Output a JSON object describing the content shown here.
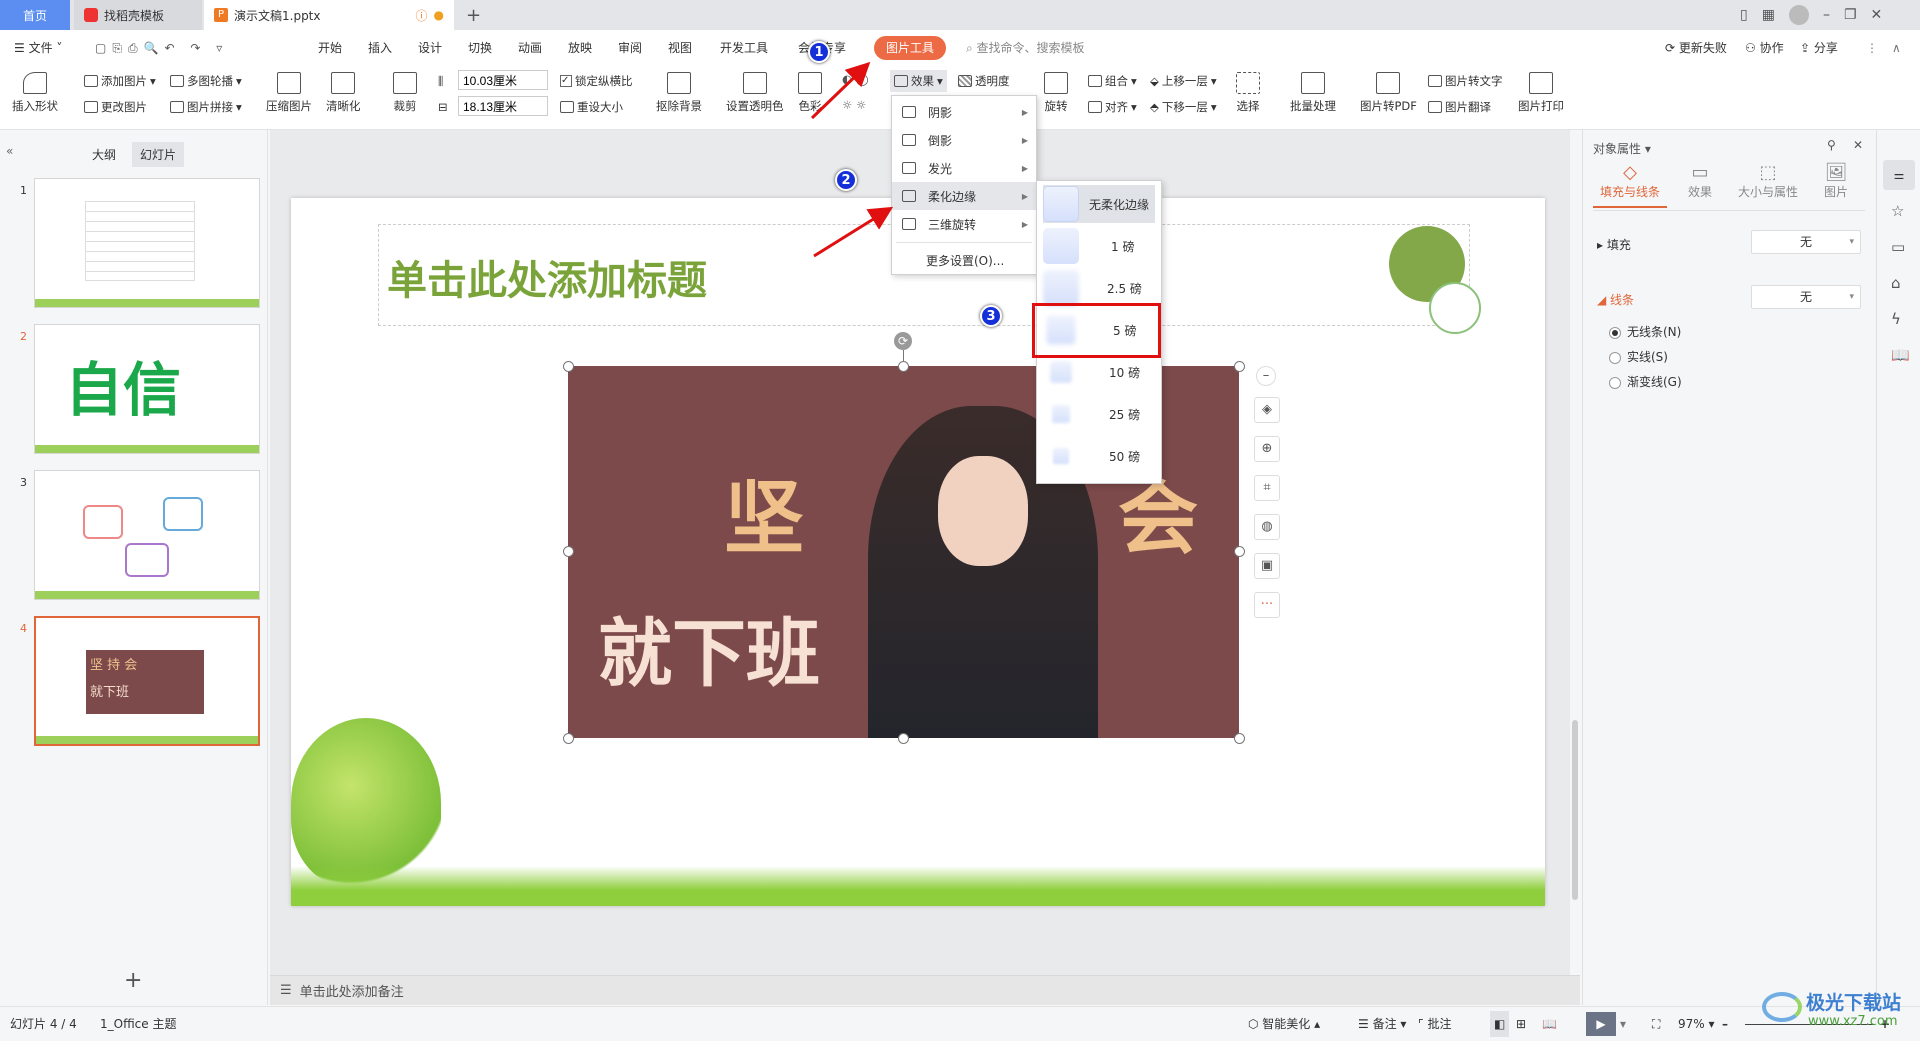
{
  "tabs": [
    {
      "label": "首页",
      "active": false
    },
    {
      "label": "找稻壳模板"
    },
    {
      "label": "演示文稿1.pptx",
      "active": true
    }
  ],
  "menu": {
    "file": "文件",
    "items": [
      "开始",
      "插入",
      "设计",
      "切换",
      "动画",
      "放映",
      "审阅",
      "视图",
      "开发工具",
      "会员专享"
    ],
    "picture_tools": "图片工具",
    "search_placeholder": "查找命令、搜索模板",
    "update_failed": "更新失败",
    "collab": "协作",
    "share": "分享"
  },
  "ribbon": {
    "insert_shape": "插入形状",
    "add_picture": "添加图片",
    "multi_carousel": "多图轮播",
    "change_picture": "更改图片",
    "picture_collage": "图片拼接",
    "compress": "压缩图片",
    "sharpen": "清晰化",
    "crop": "裁剪",
    "height": "10.03厘米",
    "width": "18.13厘米",
    "lock_ratio": "锁定纵横比",
    "reset_size": "重设大小",
    "remove_bg": "抠除背景",
    "set_transparent": "设置透明色",
    "color": "色彩",
    "effects": "效果",
    "transparency": "透明度",
    "rotate": "旋转",
    "group": "组合",
    "align": "对齐",
    "bring_forward": "上移一层",
    "send_backward": "下移一层",
    "select": "选择",
    "batch": "批量处理",
    "to_pdf": "图片转PDF",
    "to_text": "图片转文字",
    "translate": "图片翻译",
    "print": "图片打印"
  },
  "left_panel": {
    "outline_tab": "大纲",
    "slides_tab": "幻灯片",
    "slide_numbers": [
      "1",
      "2",
      "3",
      "4"
    ],
    "thumb2_text": "自信",
    "thumb4_text1": "坚 持 会",
    "thumb4_text2": "就下班"
  },
  "slide": {
    "title_placeholder": "单击此处添加标题",
    "pic_text1": "坚 持",
    "pic_text2": "会",
    "pic_text3": "就下班"
  },
  "effects_menu": {
    "items": [
      "阴影",
      "倒影",
      "发光",
      "柔化边缘",
      "三维旋转"
    ],
    "more": "更多设置(O)..."
  },
  "soft_edge_menu": {
    "items": [
      "无柔化边缘",
      "1 磅",
      "2.5 磅",
      "5 磅",
      "10 磅",
      "25 磅",
      "50 磅"
    ],
    "highlighted": "5 磅"
  },
  "badges": [
    "1",
    "2",
    "3"
  ],
  "notes": {
    "placeholder": "单击此处添加备注"
  },
  "right_panel": {
    "title": "对象属性",
    "tabs": [
      "填充与线条",
      "效果",
      "大小与属性",
      "图片"
    ],
    "fill_label": "填充",
    "fill_value": "无",
    "line_label": "线条",
    "line_value": "无",
    "line_options": [
      "无线条(N)",
      "实线(S)",
      "渐变线(G)"
    ],
    "selected_line_option": "无线条(N)"
  },
  "status": {
    "slide_info": "幻灯片 4 / 4",
    "theme": "1_Office 主题",
    "smart_beautify": "智能美化",
    "notes": "备注",
    "comment": "批注",
    "zoom": "97%"
  },
  "watermark": {
    "name": "极光下载站",
    "url": "www.xz7.com"
  },
  "colors": {
    "accent": "#e0663a",
    "picture_bg": "#7c4a4a",
    "title_green": "#7aa33a",
    "badge": "#1530d8",
    "highlight_red": "#e01010"
  }
}
